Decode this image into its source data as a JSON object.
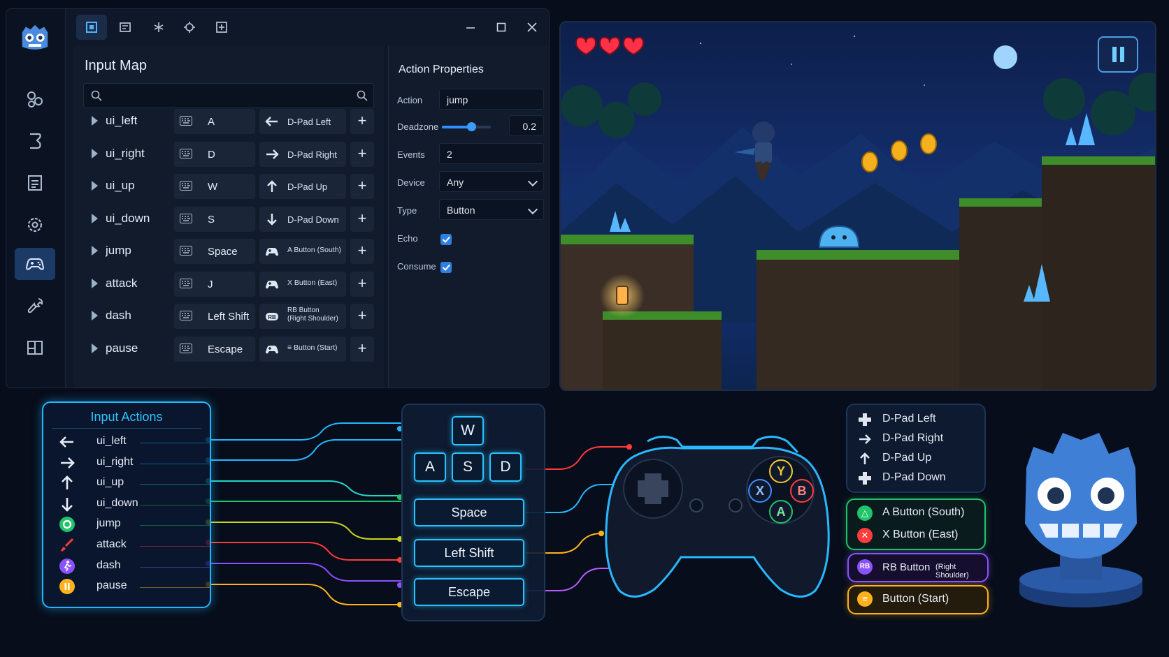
{
  "colors": {
    "accent": "#2f7fe0",
    "cyan": "#21b7ff",
    "green": "#21c46a",
    "red": "#ff3b3b",
    "purple": "#8b52ff",
    "yellow": "#ffb21c",
    "blue_godot": "#3f7fd6"
  },
  "editor": {
    "left_nav": [
      "godot-logo-icon",
      "nodes-icon",
      "script-icon",
      "filesystem-icon",
      "settings-gear-icon",
      "gamepad-icon",
      "wrench-icon",
      "layout-icon"
    ],
    "toolbar_tabs": [
      "2d-view-icon",
      "3d-view-icon",
      "script-tab-icon",
      "asset-icon",
      "export-icon"
    ],
    "input_map": {
      "title": "Input Map",
      "search_placeholder": "",
      "rows": [
        {
          "name": "ui_left",
          "key": "A",
          "pad": "D-Pad Left",
          "pad_icon": "arrow-left-icon"
        },
        {
          "name": "ui_right",
          "key": "D",
          "pad": "D-Pad Right",
          "pad_icon": "arrow-right-icon"
        },
        {
          "name": "ui_up",
          "key": "W",
          "pad": "D-Pad Up",
          "pad_icon": "arrow-up-icon"
        },
        {
          "name": "ui_down",
          "key": "S",
          "pad": "D-Pad Down",
          "pad_icon": "arrow-down-icon"
        },
        {
          "name": "jump",
          "key": "Space",
          "pad": "A Button (South)",
          "pad_icon": "gamepad-icon"
        },
        {
          "name": "attack",
          "key": "J",
          "pad": "X Button (East)",
          "pad_icon": "gamepad-icon"
        },
        {
          "name": "dash",
          "key": "Left Shift",
          "pad": "RB Button (Right Shoulder)",
          "pad_line1": "RB Button",
          "pad_line2": "(Right Shoulder)",
          "pad_icon": "rb-icon"
        },
        {
          "name": "pause",
          "key": "Escape",
          "pad": "≡ Button (Start)",
          "pad_icon": "gamepad-icon"
        }
      ],
      "plus": "+"
    },
    "action_properties": {
      "title": "Action Properties",
      "action_label": "Action",
      "action_value": "jump",
      "deadzone_label": "Deadzone",
      "deadzone_value": "0.2",
      "deadzone_fraction": 0.6,
      "events_label": "Events",
      "events_value": "2",
      "device_label": "Device",
      "device_value": "Any",
      "type_label": "Type",
      "type_value": "Button",
      "echo_label": "Echo",
      "echo_checked": true,
      "consume_label": "Consume",
      "consume_checked": true
    }
  },
  "game": {
    "hearts": 3,
    "coins": 3,
    "pause_icon": "pause-icon"
  },
  "input_actions": {
    "title": "Input Actions",
    "items": [
      {
        "label": "ui_left",
        "icon": "arrow-left-icon",
        "color": "#21b7ff"
      },
      {
        "label": "ui_right",
        "icon": "arrow-right-icon",
        "color": "#21b7ff"
      },
      {
        "label": "ui_up",
        "icon": "arrow-up-icon",
        "color": "#21d7c8"
      },
      {
        "label": "ui_down",
        "icon": "arrow-down-icon",
        "color": "#21c46a"
      },
      {
        "label": "jump",
        "icon": "circle-icon",
        "color": "#21c46a"
      },
      {
        "label": "attack",
        "icon": "sword-icon",
        "color": "#ff3b3b"
      },
      {
        "label": "dash",
        "icon": "run-icon",
        "color": "#8b52ff"
      },
      {
        "label": "pause",
        "icon": "pause-icon",
        "color": "#ffb21c"
      }
    ]
  },
  "keyboard": {
    "w": "W",
    "a": "A",
    "s": "S",
    "d": "D",
    "space": "Space",
    "shift": "Left Shift",
    "escape": "Escape"
  },
  "gamepad": {
    "y": "Y",
    "x": "X",
    "b": "B",
    "a": "A"
  },
  "bindings": {
    "dpad": [
      "D-Pad Left",
      "D-Pad Right",
      "D-Pad Up",
      "D-Pad Down"
    ],
    "a_button": "A Button (South)",
    "x_button": "X Button (East)",
    "rb_main": "RB Button",
    "rb_sub": "(Right Shoulder)",
    "rb_badge": "RB",
    "start": "Button (Start)"
  }
}
